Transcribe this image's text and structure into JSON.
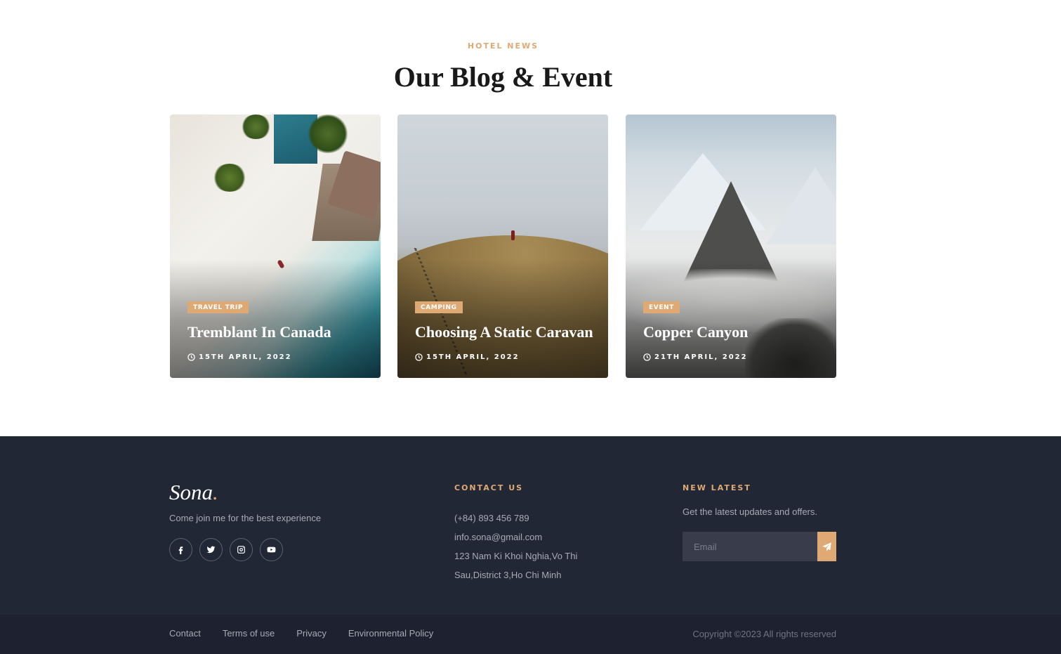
{
  "blog": {
    "kicker": "HOTEL NEWS",
    "title": "Our Blog & Event",
    "cards": [
      {
        "tag": "TRAVEL TRIP",
        "title": "Tremblant In Canada",
        "date": "15TH APRIL, 2022"
      },
      {
        "tag": "CAMPING",
        "title": "Choosing A Static Caravan",
        "date": "15TH APRIL, 2022"
      },
      {
        "tag": "EVENT",
        "title": "Copper Canyon",
        "date": "21TH APRIL, 2022"
      }
    ]
  },
  "footer": {
    "logo": "Sona",
    "logo_dot": ".",
    "tagline": "Come join me for the best experience",
    "socials": [
      "facebook-icon",
      "twitter-icon",
      "instagram-icon",
      "youtube-icon"
    ],
    "contact": {
      "heading": "CONTACT US",
      "phone": "(+84) 893 456 789",
      "email": "info.sona@gmail.com",
      "address_line1": "123 Nam Ki Khoi Nghia,Vo Thi",
      "address_line2": "Sau,District 3,Ho Chi Minh"
    },
    "newsletter": {
      "heading": "NEW LATEST",
      "text": "Get the latest updates and offers.",
      "placeholder": "Email"
    },
    "links": [
      "Contact",
      "Terms of use",
      "Privacy",
      "Environmental Policy"
    ],
    "copyright": "Copyright ©2023 All rights reserved"
  },
  "colors": {
    "accent": "#dfa974",
    "footer_bg": "#222736",
    "bottom_bar_bg": "#1d2130"
  }
}
